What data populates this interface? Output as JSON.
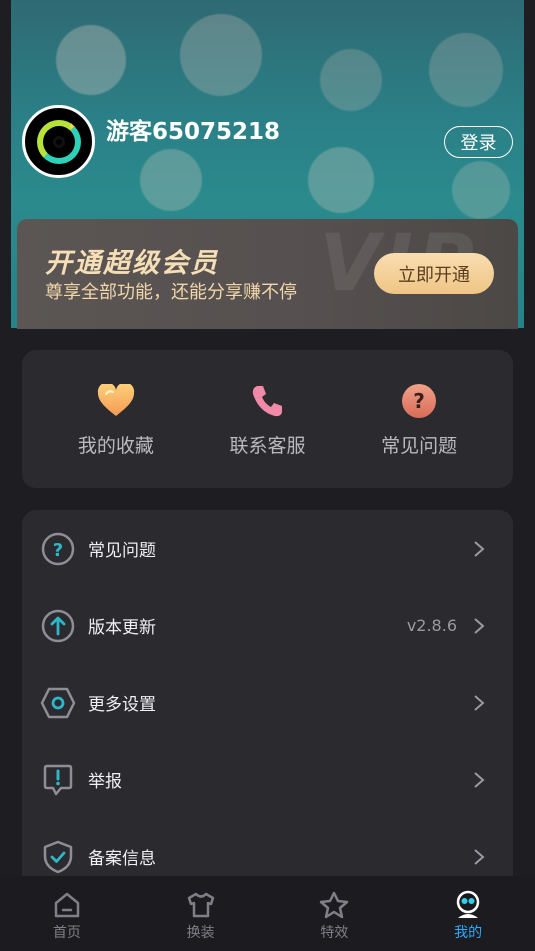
{
  "profile": {
    "username": "游客65075218",
    "login_label": "登录"
  },
  "vip": {
    "title": "开通超级会员",
    "subtitle": "尊享全部功能，还能分享赚不停",
    "button_label": "立即开通",
    "watermark": "VIP"
  },
  "quick_actions": [
    {
      "label": "我的收藏",
      "icon": "heart-icon"
    },
    {
      "label": "联系客服",
      "icon": "phone-icon"
    },
    {
      "label": "常见问题",
      "icon": "question-icon"
    }
  ],
  "menu": [
    {
      "label": "常见问题",
      "icon": "question-circle-icon",
      "value": ""
    },
    {
      "label": "版本更新",
      "icon": "upload-arrow-icon",
      "value": "v2.8.6"
    },
    {
      "label": "更多设置",
      "icon": "hexagon-settings-icon",
      "value": ""
    },
    {
      "label": "举报",
      "icon": "report-icon",
      "value": ""
    },
    {
      "label": "备案信息",
      "icon": "shield-check-icon",
      "value": ""
    }
  ],
  "tabs": [
    {
      "label": "首页",
      "icon": "home-icon"
    },
    {
      "label": "换装",
      "icon": "shirt-icon"
    },
    {
      "label": "特效",
      "icon": "star-icon"
    },
    {
      "label": "我的",
      "icon": "profile-icon",
      "active": true
    }
  ],
  "colors": {
    "accent": "#2fa8ff",
    "vip_gold": "#f6dfb6",
    "background": "#1e1e22",
    "card": "#2a2a2f"
  }
}
